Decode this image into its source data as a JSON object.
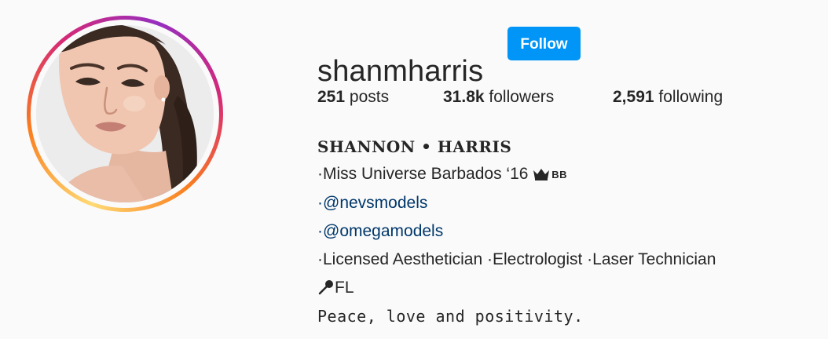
{
  "profile": {
    "username": "shanmharris",
    "follow_label": "Follow"
  },
  "stats": {
    "posts_count": "251",
    "posts_label": "posts",
    "followers_count": "31.8k",
    "followers_label": "followers",
    "following_count": "2,591",
    "following_label": "following"
  },
  "bio": {
    "full_name": "SHANNON • HARRIS",
    "line1": "·Miss Universe Barbados ‘16",
    "line1_flag": "BB",
    "line2_prefix": "·",
    "line2_link": "@nevsmodels",
    "line3_prefix": "·",
    "line3_link": "@omegamodels",
    "line4": "·Licensed Aesthetician ·Electrologist ·Laser Technician",
    "line5": "FL",
    "line6": "Peace, love and positivity."
  },
  "icons": {
    "crown": "crown-icon",
    "pin": "pin-icon"
  },
  "colors": {
    "follow_button": "#0095f6",
    "link": "#00376b",
    "text": "#262626",
    "background": "#fafafa"
  }
}
